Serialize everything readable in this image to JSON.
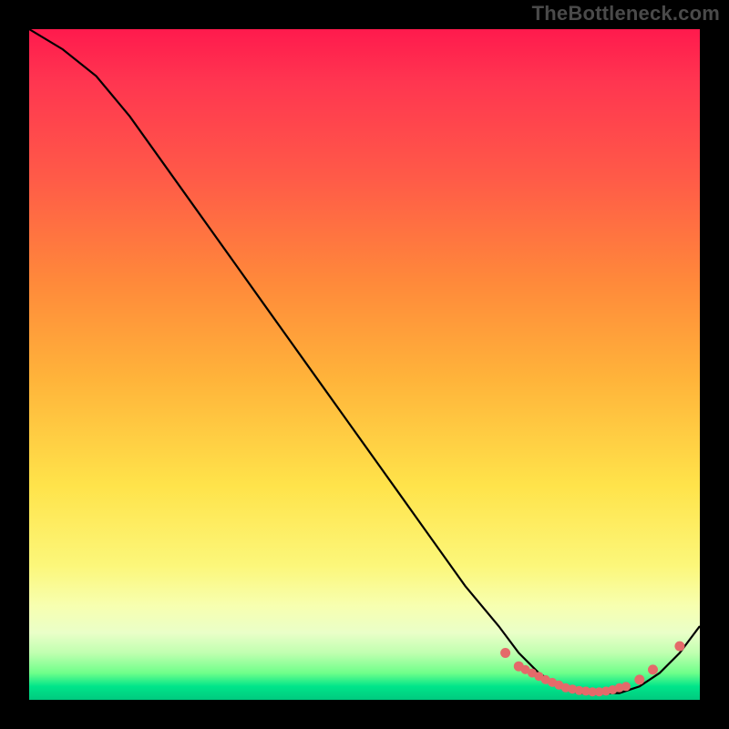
{
  "watermark": "TheBottleneck.com",
  "chart_data": {
    "type": "line",
    "title": "",
    "xlabel": "",
    "ylabel": "",
    "xlim": [
      0,
      100
    ],
    "ylim": [
      0,
      100
    ],
    "grid": false,
    "legend": false,
    "series": [
      {
        "name": "curve",
        "x": [
          0,
          5,
          10,
          15,
          20,
          25,
          30,
          35,
          40,
          45,
          50,
          55,
          60,
          65,
          70,
          73,
          76,
          79,
          82,
          85,
          88,
          91,
          94,
          97,
          100
        ],
        "y": [
          100,
          97,
          93,
          87,
          80,
          73,
          66,
          59,
          52,
          45,
          38,
          31,
          24,
          17,
          11,
          7,
          4,
          2,
          1,
          1,
          1,
          2,
          4,
          7,
          11
        ]
      }
    ],
    "markers": {
      "name": "highlight-points",
      "color": "#e46a6a",
      "x": [
        71,
        73,
        74,
        75,
        76,
        77,
        78,
        79,
        80,
        81,
        82,
        83,
        84,
        85,
        86,
        87,
        88,
        89,
        91,
        93,
        97
      ],
      "y": [
        7,
        5,
        4.5,
        4,
        3.5,
        3,
        2.6,
        2.2,
        1.8,
        1.6,
        1.4,
        1.3,
        1.2,
        1.2,
        1.3,
        1.5,
        1.8,
        2,
        3,
        4.5,
        8
      ]
    },
    "background_gradient": {
      "direction": "vertical",
      "stops": [
        {
          "pos": 0.0,
          "color": "#ff1a4d"
        },
        {
          "pos": 0.22,
          "color": "#ff5a48"
        },
        {
          "pos": 0.52,
          "color": "#ffb33a"
        },
        {
          "pos": 0.8,
          "color": "#fcf77a"
        },
        {
          "pos": 0.93,
          "color": "#c0ffb0"
        },
        {
          "pos": 1.0,
          "color": "#00c97f"
        }
      ]
    }
  }
}
